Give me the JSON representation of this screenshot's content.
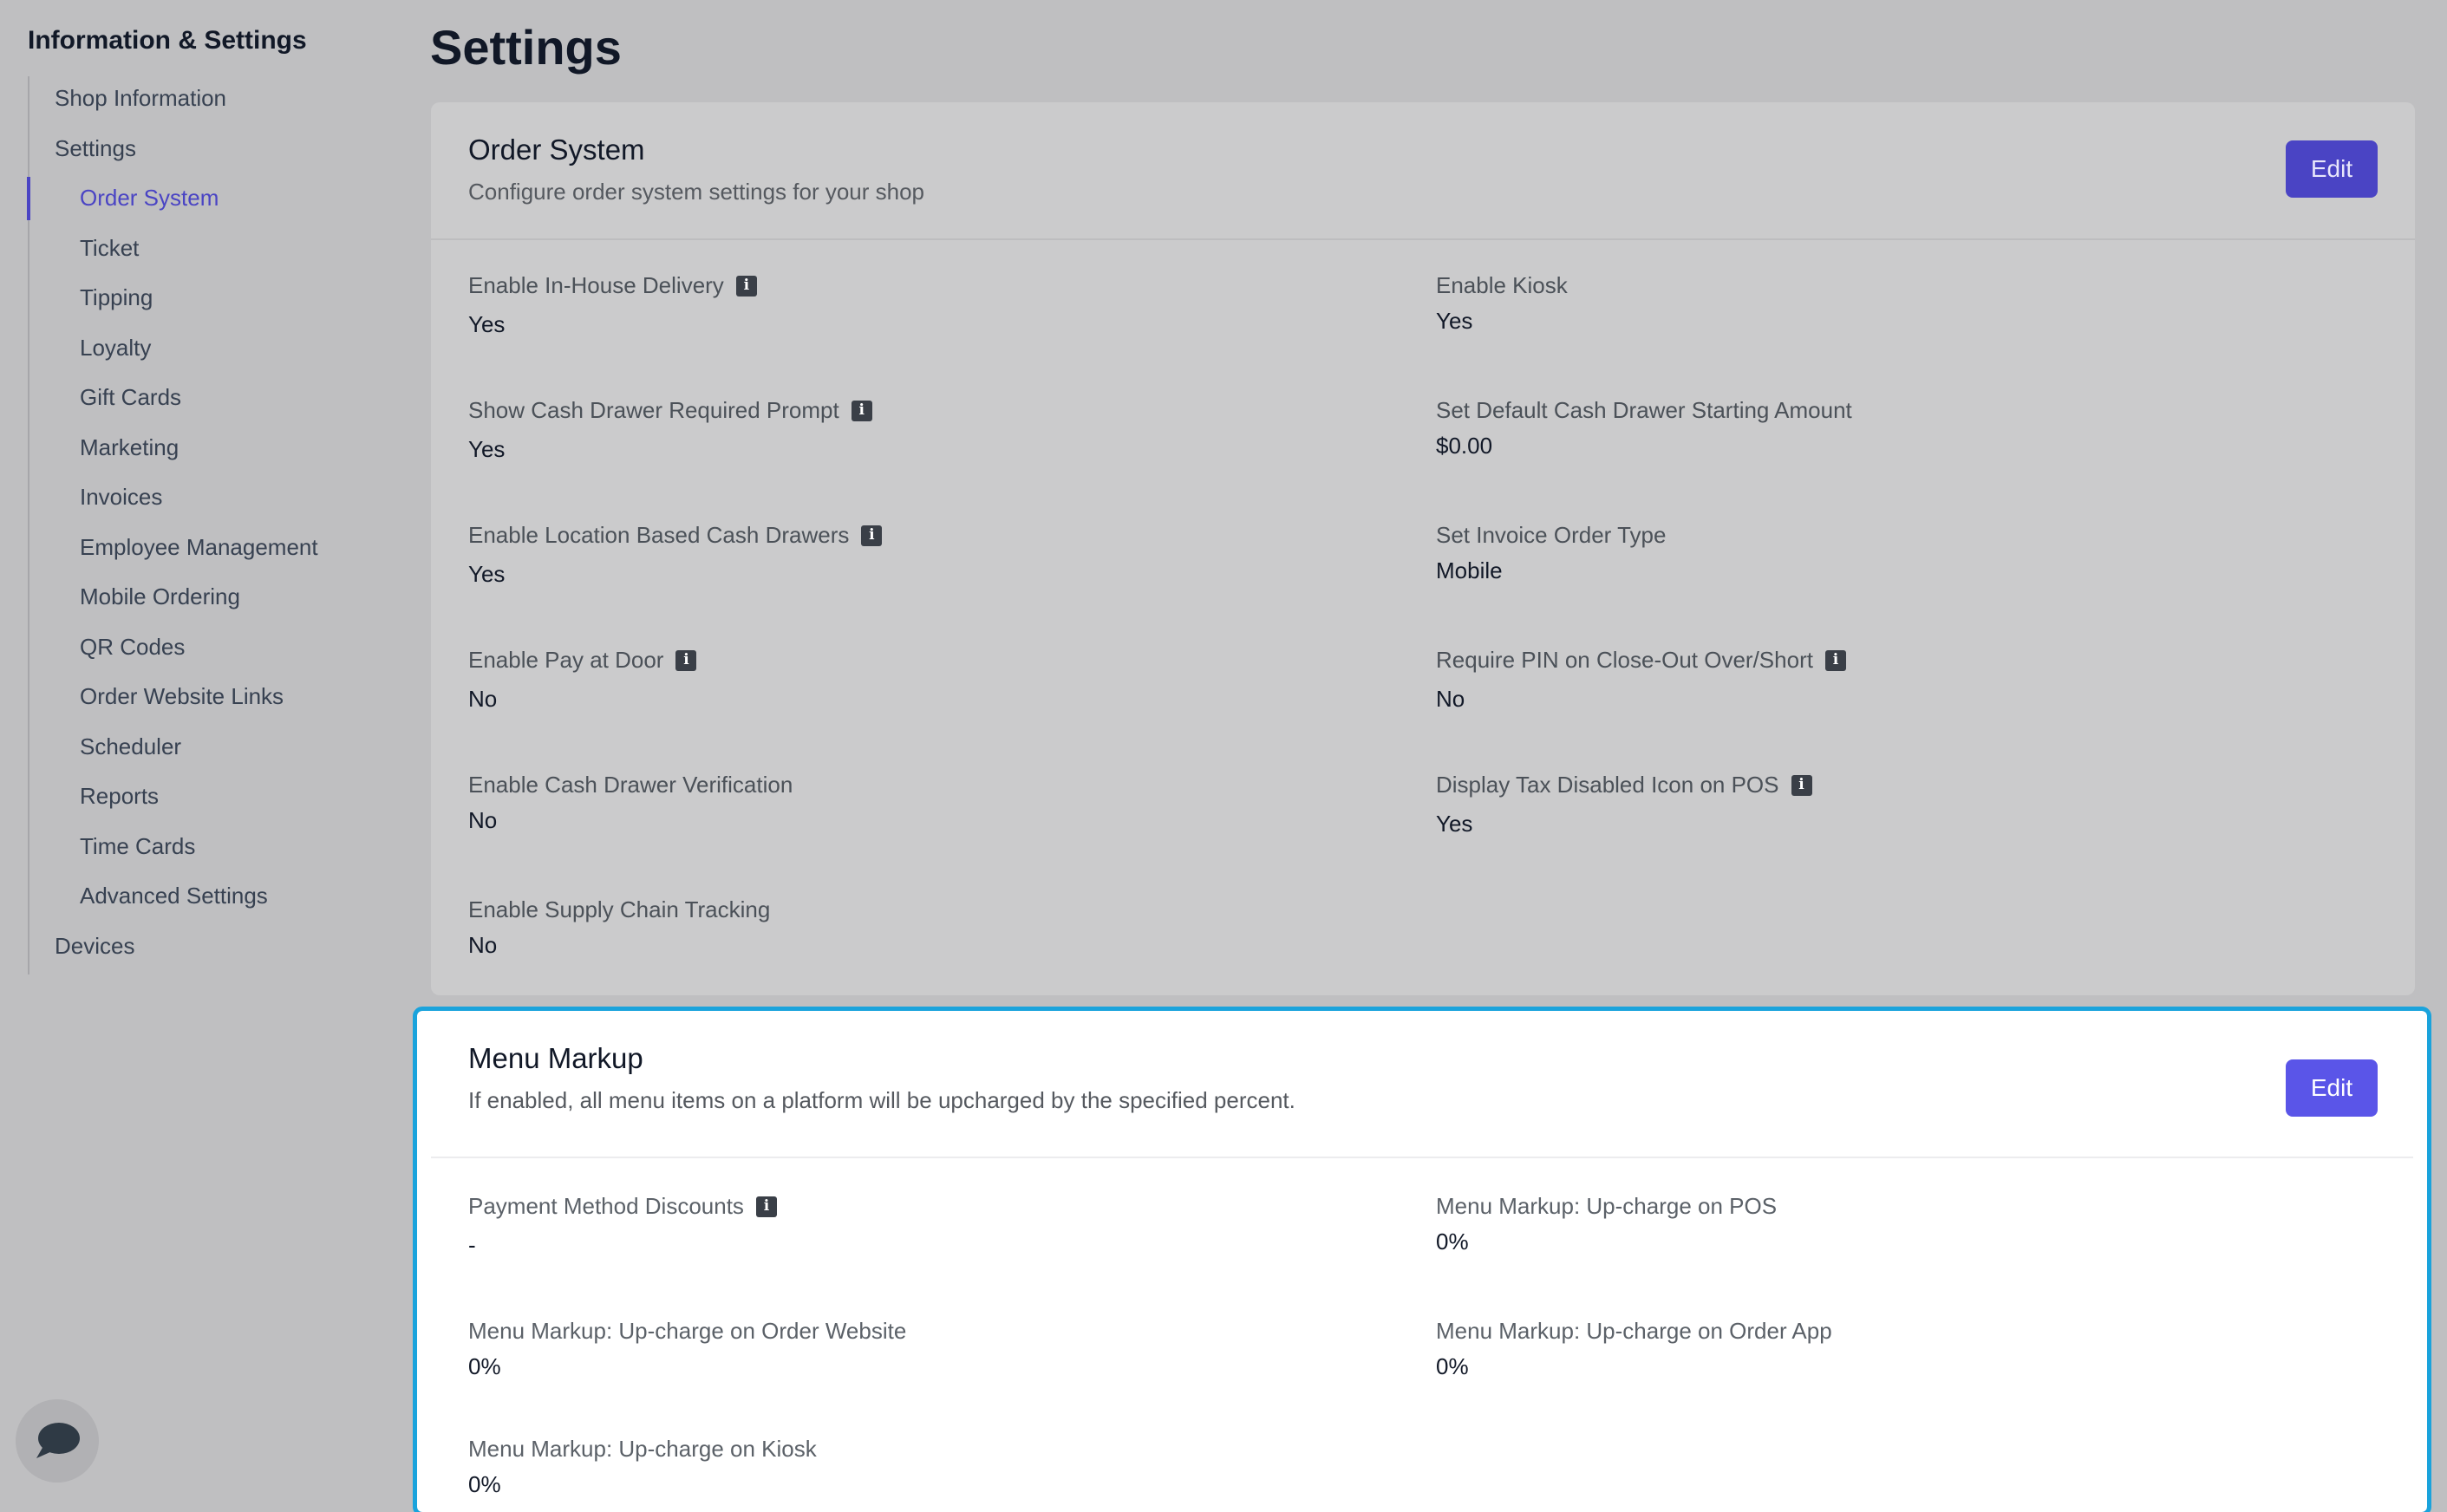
{
  "sidebar": {
    "title": "Information & Settings",
    "items": [
      {
        "label": "Shop Information"
      },
      {
        "label": "Settings"
      },
      {
        "label": "Order System"
      },
      {
        "label": "Ticket"
      },
      {
        "label": "Tipping"
      },
      {
        "label": "Loyalty"
      },
      {
        "label": "Gift Cards"
      },
      {
        "label": "Marketing"
      },
      {
        "label": "Invoices"
      },
      {
        "label": "Employee Management"
      },
      {
        "label": "Mobile Ordering"
      },
      {
        "label": "QR Codes"
      },
      {
        "label": "Order Website Links"
      },
      {
        "label": "Scheduler"
      },
      {
        "label": "Reports"
      },
      {
        "label": "Time Cards"
      },
      {
        "label": "Advanced Settings"
      },
      {
        "label": "Devices"
      }
    ],
    "active_item": "Order System",
    "accent_color": "#4a44c4"
  },
  "page": {
    "title": "Settings"
  },
  "order_system": {
    "title": "Order System",
    "subtitle": "Configure order system settings for your shop",
    "edit_label": "Edit",
    "fields": [
      {
        "label": "Enable In-House Delivery",
        "value": "Yes",
        "info": true
      },
      {
        "label": "Enable Kiosk",
        "value": "Yes",
        "info": false
      },
      {
        "label": "Show Cash Drawer Required Prompt",
        "value": "Yes",
        "info": true
      },
      {
        "label": "Set Default Cash Drawer Starting Amount",
        "value": "$0.00",
        "info": false
      },
      {
        "label": "Enable Location Based Cash Drawers",
        "value": "Yes",
        "info": true
      },
      {
        "label": "Set Invoice Order Type",
        "value": "Mobile",
        "info": false
      },
      {
        "label": "Enable Pay at Door",
        "value": "No",
        "info": true
      },
      {
        "label": "Require PIN on Close-Out Over/Short",
        "value": "No",
        "info": true
      },
      {
        "label": "Enable Cash Drawer Verification",
        "value": "No",
        "info": false
      },
      {
        "label": "Display Tax Disabled Icon on POS",
        "value": "Yes",
        "info": true
      },
      {
        "label": "Enable Supply Chain Tracking",
        "value": "No",
        "info": false
      }
    ]
  },
  "menu_markup": {
    "title": "Menu Markup",
    "subtitle": "If enabled, all menu items on a platform will be upcharged by the specified percent.",
    "edit_label": "Edit",
    "fields": [
      {
        "label": "Payment Method Discounts",
        "value": "-",
        "info": true
      },
      {
        "label": "Menu Markup: Up-charge on POS",
        "value": "0%",
        "info": false
      },
      {
        "label": "Menu Markup: Up-charge on Order Website",
        "value": "0%",
        "info": false
      },
      {
        "label": "Menu Markup: Up-charge on Order App",
        "value": "0%",
        "info": false
      },
      {
        "label": "Menu Markup: Up-charge on Kiosk",
        "value": "0%",
        "info": false
      }
    ],
    "highlight_color": "#1aa3dc"
  }
}
